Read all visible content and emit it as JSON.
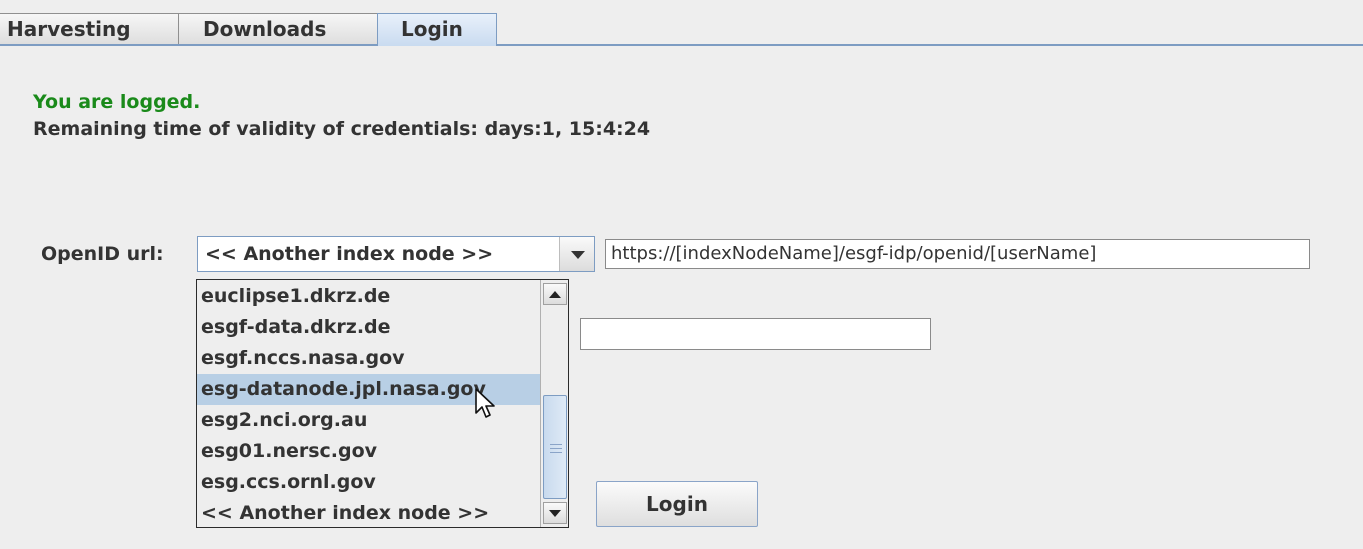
{
  "tabs": [
    {
      "label": "Harvesting",
      "active": false
    },
    {
      "label": "Downloads",
      "active": false
    },
    {
      "label": "Login",
      "active": true
    }
  ],
  "status": {
    "logged_message": "You are logged.",
    "validity_message": "Remaining time of validity of credentials: days:1, 15:4:24",
    "logged_color": "#1a8a1a"
  },
  "openid": {
    "label": "OpenID url:",
    "selected": "<< Another index node >>",
    "url_value": "https://[indexNodeName]/esgf-idp/openid/[userName]"
  },
  "dropdown": {
    "options": [
      "euclipse1.dkrz.de",
      "esgf-data.dkrz.de",
      "esgf.nccs.nasa.gov",
      "esg-datanode.jpl.nasa.gov",
      "esg2.nci.org.au",
      "esg01.nersc.gov",
      "esg.ccs.ornl.gov",
      "<< Another index node >>"
    ],
    "highlighted": "esg-datanode.jpl.nasa.gov"
  },
  "login_button": {
    "label": "Login"
  },
  "colors": {
    "accent": "#7d9cc2",
    "selection": "#b8cfe5",
    "background": "#eeeeee"
  }
}
